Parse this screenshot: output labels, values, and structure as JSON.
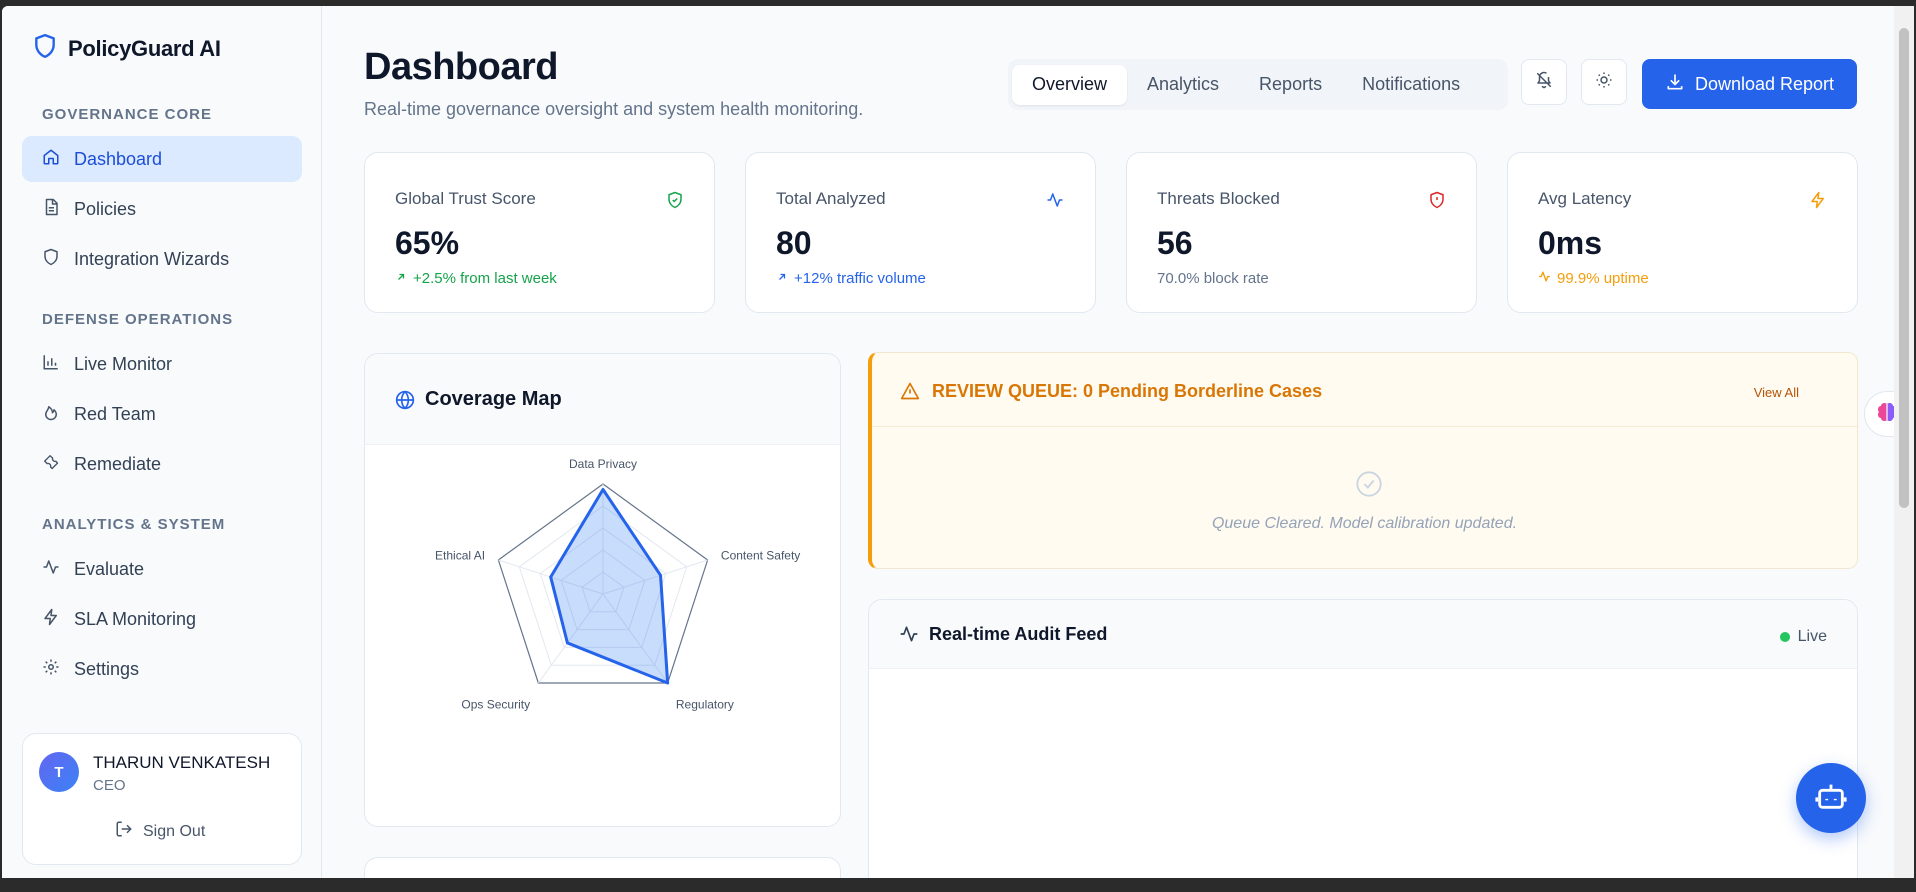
{
  "app": {
    "name": "PolicyGuard AI",
    "brand_color": "#2563eb"
  },
  "sidebar": {
    "sections": [
      {
        "title": "GOVERNANCE CORE",
        "items": [
          {
            "label": "Dashboard",
            "icon": "home-icon",
            "active": true
          },
          {
            "label": "Policies",
            "icon": "document-icon"
          },
          {
            "label": "Integration Wizards",
            "icon": "shield-icon"
          }
        ]
      },
      {
        "title": "DEFENSE OPERATIONS",
        "items": [
          {
            "label": "Live Monitor",
            "icon": "bar-chart-icon"
          },
          {
            "label": "Red Team",
            "icon": "flame-icon"
          },
          {
            "label": "Remediate",
            "icon": "wrench-icon"
          }
        ]
      },
      {
        "title": "ANALYTICS & SYSTEM",
        "items": [
          {
            "label": "Evaluate",
            "icon": "activity-icon"
          },
          {
            "label": "SLA Monitoring",
            "icon": "bolt-icon"
          },
          {
            "label": "Settings",
            "icon": "gear-icon"
          }
        ]
      }
    ],
    "user": {
      "initial": "T",
      "name": "THARUN VENKATESH",
      "role": "CEO",
      "signout_label": "Sign Out"
    }
  },
  "header": {
    "title": "Dashboard",
    "subtitle": "Real-time governance oversight and system health monitoring.",
    "tabs": [
      "Overview",
      "Analytics",
      "Reports",
      "Notifications"
    ],
    "active_tab": "Overview",
    "download_label": "Download Report"
  },
  "stats": [
    {
      "label": "Global Trust Score",
      "value": "65%",
      "sub": "+2.5% from last week",
      "sub_color": "#16a34a",
      "icon": "shield-check-icon",
      "icon_color": "#16a34a"
    },
    {
      "label": "Total Analyzed",
      "value": "80",
      "sub": "+12% traffic volume",
      "sub_color": "#2563eb",
      "icon": "activity-icon",
      "icon_color": "#2563eb"
    },
    {
      "label": "Threats Blocked",
      "value": "56",
      "sub": "70.0% block rate",
      "sub_color": "#64748b",
      "icon": "shield-alert-icon",
      "icon_color": "#dc2626"
    },
    {
      "label": "Avg Latency",
      "value": "0ms",
      "sub": "99.9% uptime",
      "sub_color": "#f59e0b",
      "icon": "bolt-icon",
      "icon_color": "#f59e0b"
    }
  ],
  "coverage": {
    "title": "Coverage Map",
    "chart_data": {
      "type": "radar",
      "categories": [
        "Data Privacy",
        "Content Safety",
        "Regulatory",
        "Ops Security",
        "Ethical AI"
      ],
      "values": [
        95,
        55,
        100,
        55,
        50
      ],
      "max": 100
    }
  },
  "review": {
    "title": "REVIEW QUEUE: 0 Pending Borderline Cases",
    "view_all_label": "View All",
    "empty_message": "Queue Cleared. Model calibration updated."
  },
  "audit": {
    "title": "Real-time Audit Feed",
    "live_label": "Live"
  }
}
